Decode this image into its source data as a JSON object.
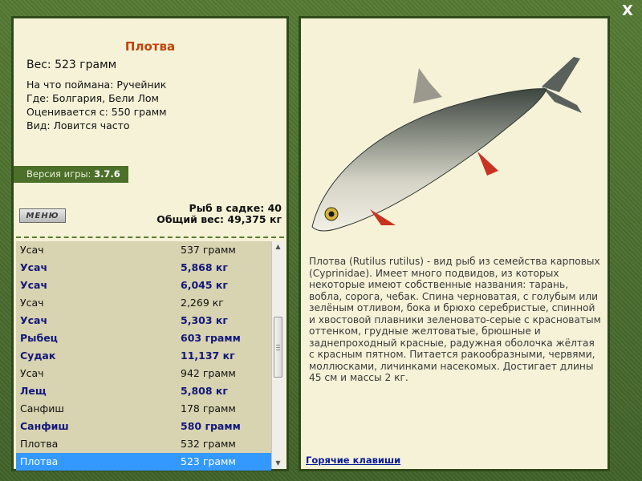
{
  "window": {
    "close_label": "X"
  },
  "fish": {
    "name": "Плотва",
    "weight": "Вес: 523 грамм",
    "caught_on": "На что поймана: Ручейник",
    "location": "Где: Болгария, Бели Лом",
    "valued_from": "Оценивается с: 550 грамм",
    "type": "Вид: Ловится часто"
  },
  "version": {
    "label": "Версия игры: ",
    "value": "3.7.6"
  },
  "menu_button": {
    "label": "МЕНЮ"
  },
  "stats": {
    "fish_in_keepnet": "Рыб в садке: 40",
    "total_weight": "Общий вес: 49,375 кг"
  },
  "catch_list": [
    {
      "name": "Усач",
      "weight": "537 грамм",
      "big": false
    },
    {
      "name": "Усач",
      "weight": "5,868 кг",
      "big": true
    },
    {
      "name": "Усач",
      "weight": "6,045 кг",
      "big": true
    },
    {
      "name": "Усач",
      "weight": "2,269 кг",
      "big": false
    },
    {
      "name": "Усач",
      "weight": "5,303 кг",
      "big": true
    },
    {
      "name": "Рыбец",
      "weight": "603 грамм",
      "big": true
    },
    {
      "name": "Судак",
      "weight": "11,137 кг",
      "big": true
    },
    {
      "name": "Усач",
      "weight": "942 грамм",
      "big": false
    },
    {
      "name": "Лещ",
      "weight": "5,808 кг",
      "big": true
    },
    {
      "name": "Санфиш",
      "weight": "178 грамм",
      "big": false
    },
    {
      "name": "Санфиш",
      "weight": "580 грамм",
      "big": true
    },
    {
      "name": "Плотва",
      "weight": "532 грамм",
      "big": false
    },
    {
      "name": "Плотва",
      "weight": "523 грамм",
      "big": false,
      "selected": true
    }
  ],
  "description": "Плотва (Rutilus rutilus) - вид рыб из семейства карповых (Cyprinidae). Имеет много подвидов, из которых некоторые имеют собственные названия: тарань, вобла, сорога, чебак. Спина черноватая, с голубым или зелёным отливом, бока и брюхо серебристые, спинной и хвостовой плавники зеленовато-серые с красноватым оттенком, грудные желтоватые, брюшные и заднепроходный красные, радужная оболочка жёлтая с красным пятном. Питается ракообразными, червями, моллюсками, личинками насекомых. Достигает длины 45 см и массы 2 кг.",
  "hotkeys_link": "Горячие клавиши",
  "colors": {
    "accent": "#c0440b",
    "big_catch": "#12187a",
    "selected": "#3399ff",
    "frame": "#4b6b2d"
  }
}
